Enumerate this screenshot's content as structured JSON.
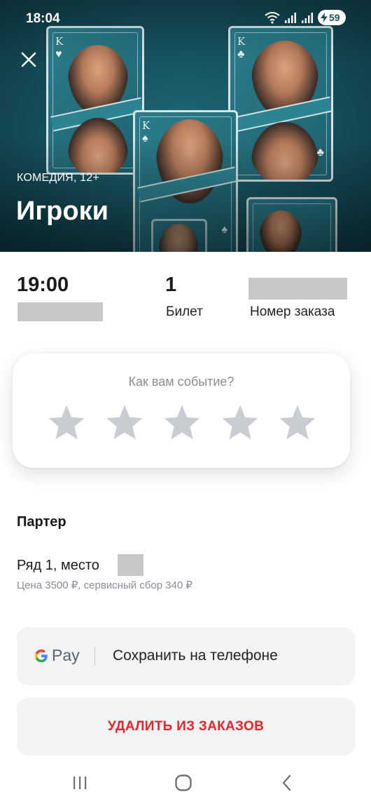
{
  "status_bar": {
    "time": "18:04",
    "battery_level": "59",
    "icons": [
      "wifi-icon",
      "signal-icon",
      "signal-icon",
      "battery-charging-icon"
    ]
  },
  "event": {
    "genre_age": "КОМЕДИЯ, 12+",
    "title": "Игроки",
    "time": "19:00",
    "ticket_count": "1",
    "ticket_label": "Билет",
    "order_number_label": "Номер заказа"
  },
  "rating": {
    "question": "Как вам событие?",
    "max_stars": 5,
    "selected": 0
  },
  "seat": {
    "section": "Партер",
    "row_seat": "Ряд 1, место",
    "price": "Цена 3500 ₽, сервисный сбор 340 ₽"
  },
  "actions": {
    "gpay_brand_g": "G",
    "gpay_brand_pay": "Pay",
    "gpay_label": "Сохранить на телефоне",
    "delete_label": "УДАЛИТЬ ИЗ ЗАКАЗОВ"
  },
  "colors": {
    "hero_teal": "#16525f",
    "delete_red": "#e3242b",
    "star_gray": "#c9ccd1",
    "button_bg": "#f2f3f5"
  },
  "navigation": [
    "recent-apps-icon",
    "home-icon",
    "back-icon"
  ]
}
